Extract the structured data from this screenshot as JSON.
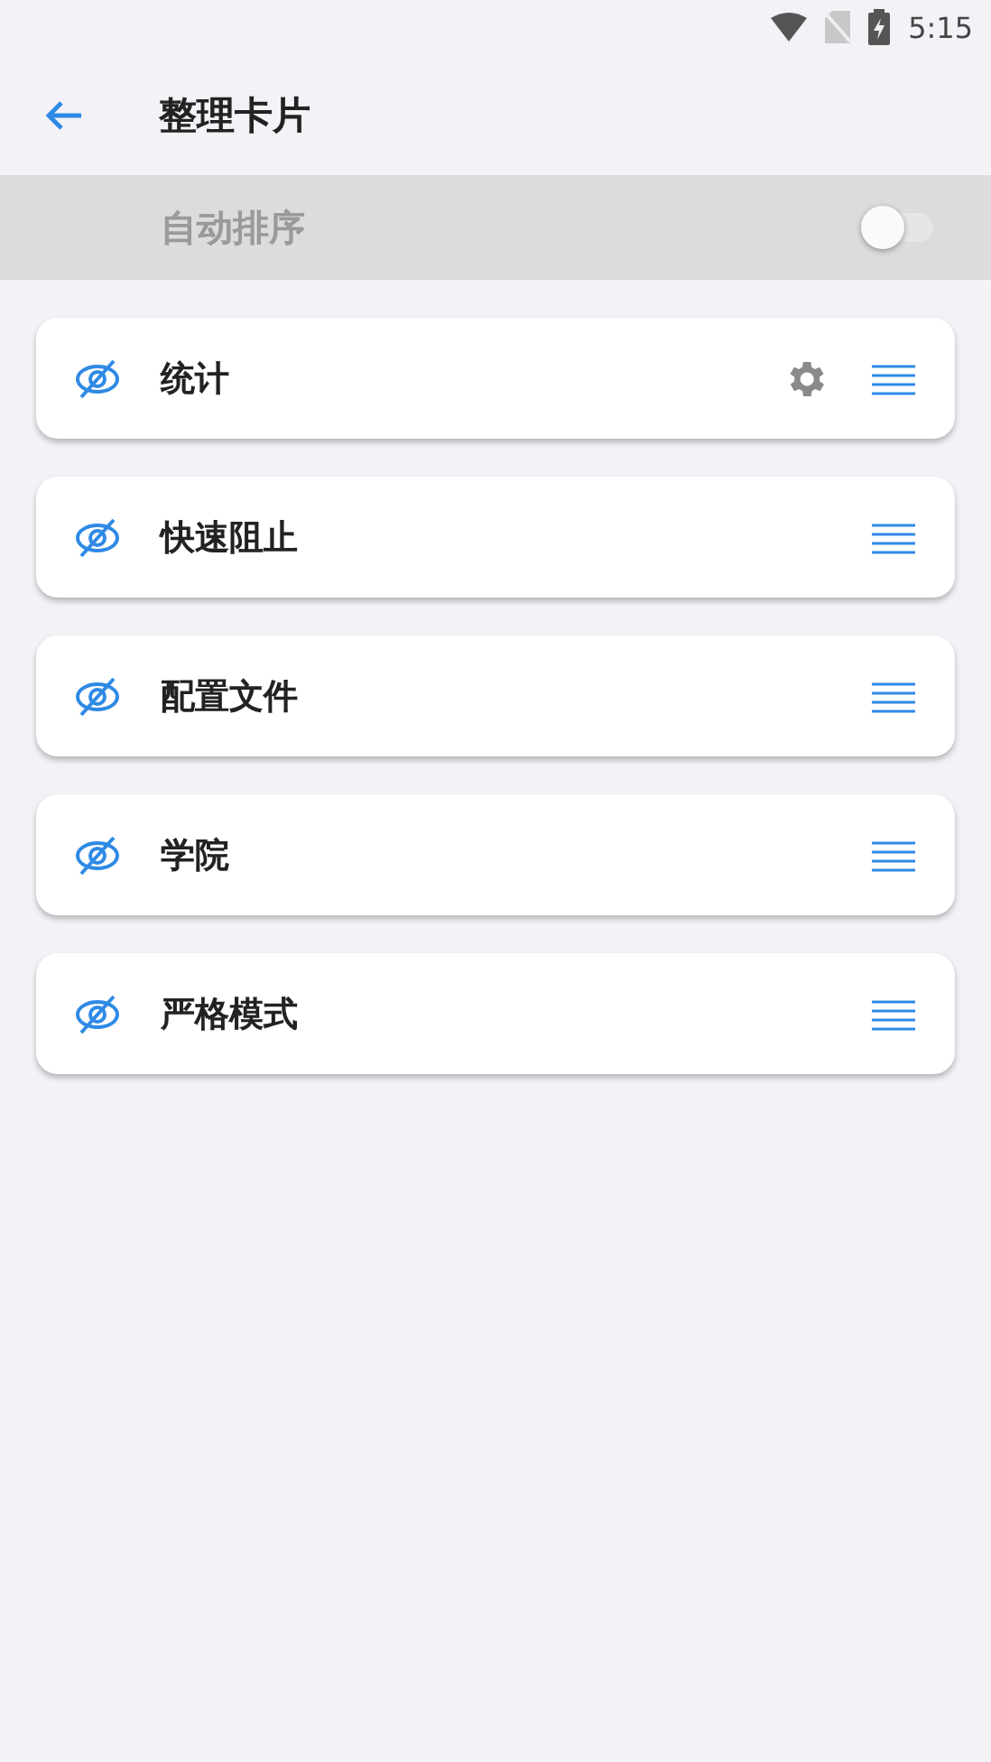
{
  "status_bar": {
    "time": "5:15"
  },
  "app_bar": {
    "title": "整理卡片"
  },
  "auto_sort": {
    "label": "自动排序",
    "on": false,
    "disabled": true
  },
  "cards": [
    {
      "label": "统计",
      "settings": true
    },
    {
      "label": "快速阻止",
      "settings": false
    },
    {
      "label": "配置文件",
      "settings": false
    },
    {
      "label": "学院",
      "settings": false
    },
    {
      "label": "严格模式",
      "settings": false
    }
  ]
}
